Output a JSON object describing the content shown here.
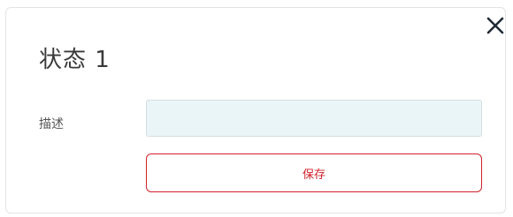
{
  "dialog": {
    "title": "状态 1",
    "close_icon": "close-icon",
    "description": {
      "label": "描述",
      "value": "",
      "placeholder": ""
    },
    "save_label": "保存"
  },
  "colors": {
    "accent": "#d0202a",
    "input_background": "#eaf5f8",
    "title_text": "#3a3a3a"
  }
}
